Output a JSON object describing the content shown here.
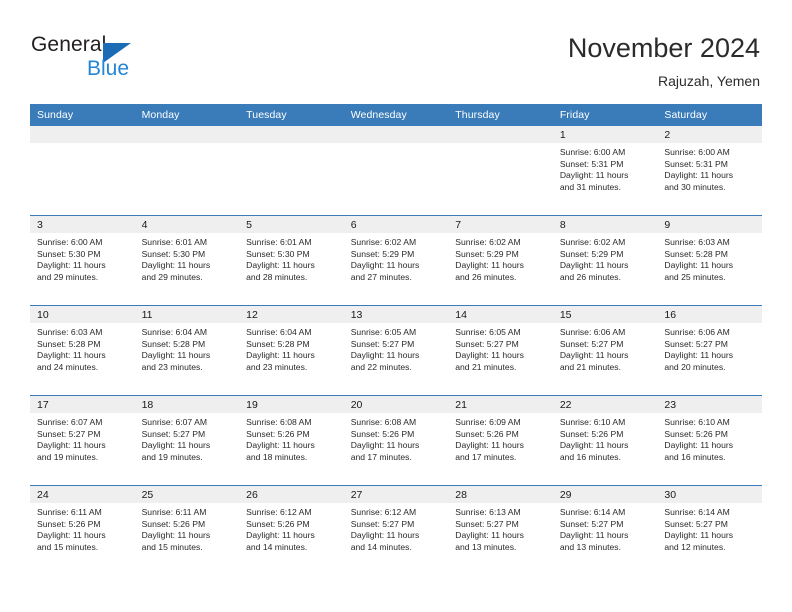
{
  "brand": {
    "line1": "General",
    "line2": "Blue",
    "triangle_color": "#1b6bb5",
    "blue_text_color": "#2387d6"
  },
  "header": {
    "title": "November 2024",
    "subtitle": "Rajuzah, Yemen"
  },
  "theme": {
    "header_row_bg": "#3a7cba",
    "daynum_bg": "#efefef",
    "cell_bg": "#ffffff",
    "grid_line": "#3a7cba",
    "text": "#2a2a2a"
  },
  "weekday_headers": [
    "Sunday",
    "Monday",
    "Tuesday",
    "Wednesday",
    "Thursday",
    "Friday",
    "Saturday"
  ],
  "weeks": [
    [
      {
        "day": "",
        "empty": true,
        "sunrise": "",
        "sunset": "",
        "daylight_l1": "",
        "daylight_l2": ""
      },
      {
        "day": "",
        "empty": true,
        "sunrise": "",
        "sunset": "",
        "daylight_l1": "",
        "daylight_l2": ""
      },
      {
        "day": "",
        "empty": true,
        "sunrise": "",
        "sunset": "",
        "daylight_l1": "",
        "daylight_l2": ""
      },
      {
        "day": "",
        "empty": true,
        "sunrise": "",
        "sunset": "",
        "daylight_l1": "",
        "daylight_l2": ""
      },
      {
        "day": "",
        "empty": true,
        "sunrise": "",
        "sunset": "",
        "daylight_l1": "",
        "daylight_l2": ""
      },
      {
        "day": "1",
        "empty": false,
        "sunrise": "Sunrise: 6:00 AM",
        "sunset": "Sunset: 5:31 PM",
        "daylight_l1": "Daylight: 11 hours",
        "daylight_l2": "and 31 minutes."
      },
      {
        "day": "2",
        "empty": false,
        "sunrise": "Sunrise: 6:00 AM",
        "sunset": "Sunset: 5:31 PM",
        "daylight_l1": "Daylight: 11 hours",
        "daylight_l2": "and 30 minutes."
      }
    ],
    [
      {
        "day": "3",
        "empty": false,
        "sunrise": "Sunrise: 6:00 AM",
        "sunset": "Sunset: 5:30 PM",
        "daylight_l1": "Daylight: 11 hours",
        "daylight_l2": "and 29 minutes."
      },
      {
        "day": "4",
        "empty": false,
        "sunrise": "Sunrise: 6:01 AM",
        "sunset": "Sunset: 5:30 PM",
        "daylight_l1": "Daylight: 11 hours",
        "daylight_l2": "and 29 minutes."
      },
      {
        "day": "5",
        "empty": false,
        "sunrise": "Sunrise: 6:01 AM",
        "sunset": "Sunset: 5:30 PM",
        "daylight_l1": "Daylight: 11 hours",
        "daylight_l2": "and 28 minutes."
      },
      {
        "day": "6",
        "empty": false,
        "sunrise": "Sunrise: 6:02 AM",
        "sunset": "Sunset: 5:29 PM",
        "daylight_l1": "Daylight: 11 hours",
        "daylight_l2": "and 27 minutes."
      },
      {
        "day": "7",
        "empty": false,
        "sunrise": "Sunrise: 6:02 AM",
        "sunset": "Sunset: 5:29 PM",
        "daylight_l1": "Daylight: 11 hours",
        "daylight_l2": "and 26 minutes."
      },
      {
        "day": "8",
        "empty": false,
        "sunrise": "Sunrise: 6:02 AM",
        "sunset": "Sunset: 5:29 PM",
        "daylight_l1": "Daylight: 11 hours",
        "daylight_l2": "and 26 minutes."
      },
      {
        "day": "9",
        "empty": false,
        "sunrise": "Sunrise: 6:03 AM",
        "sunset": "Sunset: 5:28 PM",
        "daylight_l1": "Daylight: 11 hours",
        "daylight_l2": "and 25 minutes."
      }
    ],
    [
      {
        "day": "10",
        "empty": false,
        "sunrise": "Sunrise: 6:03 AM",
        "sunset": "Sunset: 5:28 PM",
        "daylight_l1": "Daylight: 11 hours",
        "daylight_l2": "and 24 minutes."
      },
      {
        "day": "11",
        "empty": false,
        "sunrise": "Sunrise: 6:04 AM",
        "sunset": "Sunset: 5:28 PM",
        "daylight_l1": "Daylight: 11 hours",
        "daylight_l2": "and 23 minutes."
      },
      {
        "day": "12",
        "empty": false,
        "sunrise": "Sunrise: 6:04 AM",
        "sunset": "Sunset: 5:28 PM",
        "daylight_l1": "Daylight: 11 hours",
        "daylight_l2": "and 23 minutes."
      },
      {
        "day": "13",
        "empty": false,
        "sunrise": "Sunrise: 6:05 AM",
        "sunset": "Sunset: 5:27 PM",
        "daylight_l1": "Daylight: 11 hours",
        "daylight_l2": "and 22 minutes."
      },
      {
        "day": "14",
        "empty": false,
        "sunrise": "Sunrise: 6:05 AM",
        "sunset": "Sunset: 5:27 PM",
        "daylight_l1": "Daylight: 11 hours",
        "daylight_l2": "and 21 minutes."
      },
      {
        "day": "15",
        "empty": false,
        "sunrise": "Sunrise: 6:06 AM",
        "sunset": "Sunset: 5:27 PM",
        "daylight_l1": "Daylight: 11 hours",
        "daylight_l2": "and 21 minutes."
      },
      {
        "day": "16",
        "empty": false,
        "sunrise": "Sunrise: 6:06 AM",
        "sunset": "Sunset: 5:27 PM",
        "daylight_l1": "Daylight: 11 hours",
        "daylight_l2": "and 20 minutes."
      }
    ],
    [
      {
        "day": "17",
        "empty": false,
        "sunrise": "Sunrise: 6:07 AM",
        "sunset": "Sunset: 5:27 PM",
        "daylight_l1": "Daylight: 11 hours",
        "daylight_l2": "and 19 minutes."
      },
      {
        "day": "18",
        "empty": false,
        "sunrise": "Sunrise: 6:07 AM",
        "sunset": "Sunset: 5:27 PM",
        "daylight_l1": "Daylight: 11 hours",
        "daylight_l2": "and 19 minutes."
      },
      {
        "day": "19",
        "empty": false,
        "sunrise": "Sunrise: 6:08 AM",
        "sunset": "Sunset: 5:26 PM",
        "daylight_l1": "Daylight: 11 hours",
        "daylight_l2": "and 18 minutes."
      },
      {
        "day": "20",
        "empty": false,
        "sunrise": "Sunrise: 6:08 AM",
        "sunset": "Sunset: 5:26 PM",
        "daylight_l1": "Daylight: 11 hours",
        "daylight_l2": "and 17 minutes."
      },
      {
        "day": "21",
        "empty": false,
        "sunrise": "Sunrise: 6:09 AM",
        "sunset": "Sunset: 5:26 PM",
        "daylight_l1": "Daylight: 11 hours",
        "daylight_l2": "and 17 minutes."
      },
      {
        "day": "22",
        "empty": false,
        "sunrise": "Sunrise: 6:10 AM",
        "sunset": "Sunset: 5:26 PM",
        "daylight_l1": "Daylight: 11 hours",
        "daylight_l2": "and 16 minutes."
      },
      {
        "day": "23",
        "empty": false,
        "sunrise": "Sunrise: 6:10 AM",
        "sunset": "Sunset: 5:26 PM",
        "daylight_l1": "Daylight: 11 hours",
        "daylight_l2": "and 16 minutes."
      }
    ],
    [
      {
        "day": "24",
        "empty": false,
        "sunrise": "Sunrise: 6:11 AM",
        "sunset": "Sunset: 5:26 PM",
        "daylight_l1": "Daylight: 11 hours",
        "daylight_l2": "and 15 minutes."
      },
      {
        "day": "25",
        "empty": false,
        "sunrise": "Sunrise: 6:11 AM",
        "sunset": "Sunset: 5:26 PM",
        "daylight_l1": "Daylight: 11 hours",
        "daylight_l2": "and 15 minutes."
      },
      {
        "day": "26",
        "empty": false,
        "sunrise": "Sunrise: 6:12 AM",
        "sunset": "Sunset: 5:26 PM",
        "daylight_l1": "Daylight: 11 hours",
        "daylight_l2": "and 14 minutes."
      },
      {
        "day": "27",
        "empty": false,
        "sunrise": "Sunrise: 6:12 AM",
        "sunset": "Sunset: 5:27 PM",
        "daylight_l1": "Daylight: 11 hours",
        "daylight_l2": "and 14 minutes."
      },
      {
        "day": "28",
        "empty": false,
        "sunrise": "Sunrise: 6:13 AM",
        "sunset": "Sunset: 5:27 PM",
        "daylight_l1": "Daylight: 11 hours",
        "daylight_l2": "and 13 minutes."
      },
      {
        "day": "29",
        "empty": false,
        "sunrise": "Sunrise: 6:14 AM",
        "sunset": "Sunset: 5:27 PM",
        "daylight_l1": "Daylight: 11 hours",
        "daylight_l2": "and 13 minutes."
      },
      {
        "day": "30",
        "empty": false,
        "sunrise": "Sunrise: 6:14 AM",
        "sunset": "Sunset: 5:27 PM",
        "daylight_l1": "Daylight: 11 hours",
        "daylight_l2": "and 12 minutes."
      }
    ]
  ]
}
